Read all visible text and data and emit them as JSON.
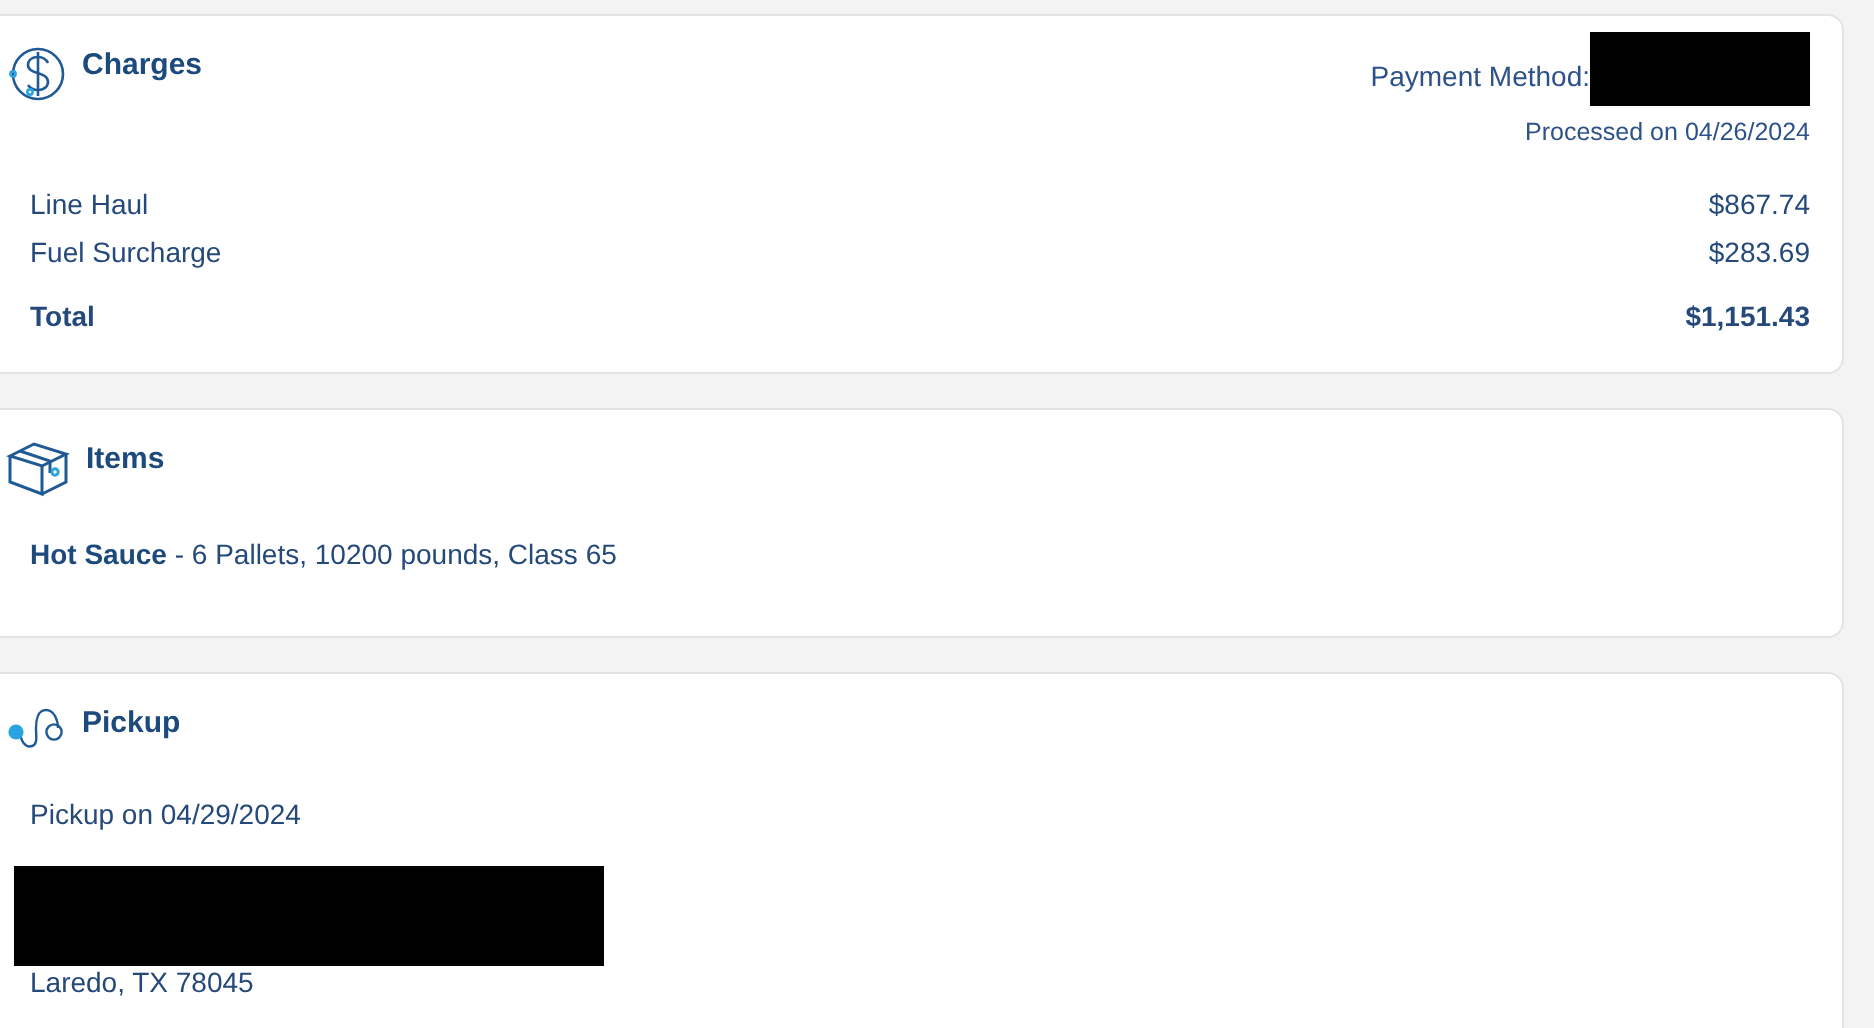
{
  "cards": [
    {
      "kind": "charges",
      "title": "Charges",
      "payment": {
        "label": "Payment Method:",
        "redacted": true
      },
      "processed": "Processed on 04/26/2024",
      "lines": [
        {
          "label": "Line Haul",
          "amount": "$867.74",
          "total": false
        },
        {
          "label": "Fuel Surcharge",
          "amount": "$283.69",
          "total": false
        },
        {
          "label": "Total",
          "amount": "$1,151.43",
          "total": true
        }
      ]
    },
    {
      "kind": "items",
      "title": "Items",
      "items": [
        "**Hot Sauce** - 6 Pallets, 10200 pounds, Class 65"
      ]
    },
    {
      "kind": "pickup",
      "title": "Pickup",
      "date": "Pickup on 04/29/2024",
      "address_redacted": true,
      "city": "Laredo, TX 78045"
    }
  ]
}
